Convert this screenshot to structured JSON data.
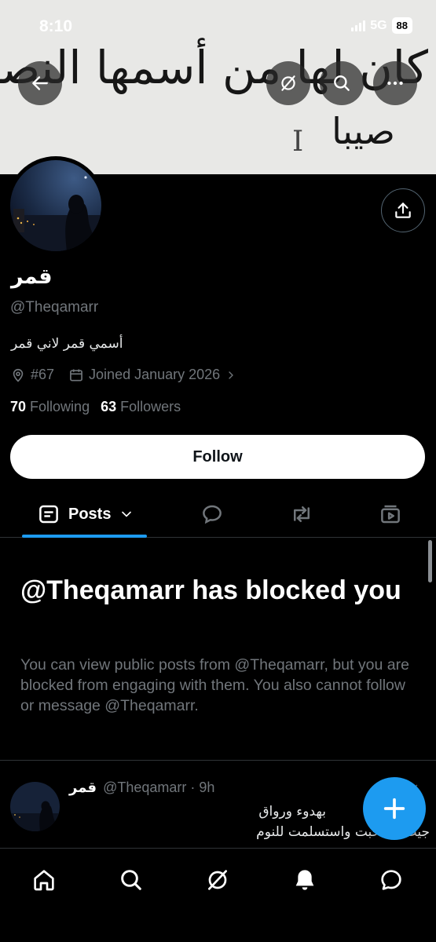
{
  "status_bar": {
    "time": "8:10",
    "network": "5G",
    "battery": "88"
  },
  "banner": {
    "line1": "كان لها من أسمها النصيب",
    "line2": "صيبا"
  },
  "header": {
    "back_icon": "arrow-left-icon",
    "grok_icon": "grok-icon",
    "search_icon": "search-icon",
    "more_icon": "more-horizontal-icon",
    "share_icon": "share-icon"
  },
  "profile": {
    "name": "قمر",
    "handle": "@Theqamarr",
    "bio": "أسمي قمر لاني قمر",
    "location": "#67",
    "joined": "Joined January 2026",
    "following_count": "70",
    "following_label": "Following",
    "followers_count": "63",
    "followers_label": "Followers",
    "follow_button": "Follow"
  },
  "tabs": {
    "posts_label": "Posts",
    "items": [
      "posts",
      "replies",
      "reposts",
      "media"
    ]
  },
  "blocked": {
    "title": "@Theqamarr has blocked you",
    "description": "You can view public posts from @Theqamarr, but you are blocked from engaging with them. You also cannot follow or message @Theqamarr."
  },
  "post": {
    "name": "قمر",
    "handle_time": "@Theqamarr · 9h",
    "line1": "بهدوء ورواق",
    "line2": "جيت انسحبت واستسلمت للنوم"
  },
  "colors": {
    "accent": "#1d9bf0",
    "background": "#000000",
    "secondary_text": "#71767b",
    "border": "#2f3336"
  }
}
